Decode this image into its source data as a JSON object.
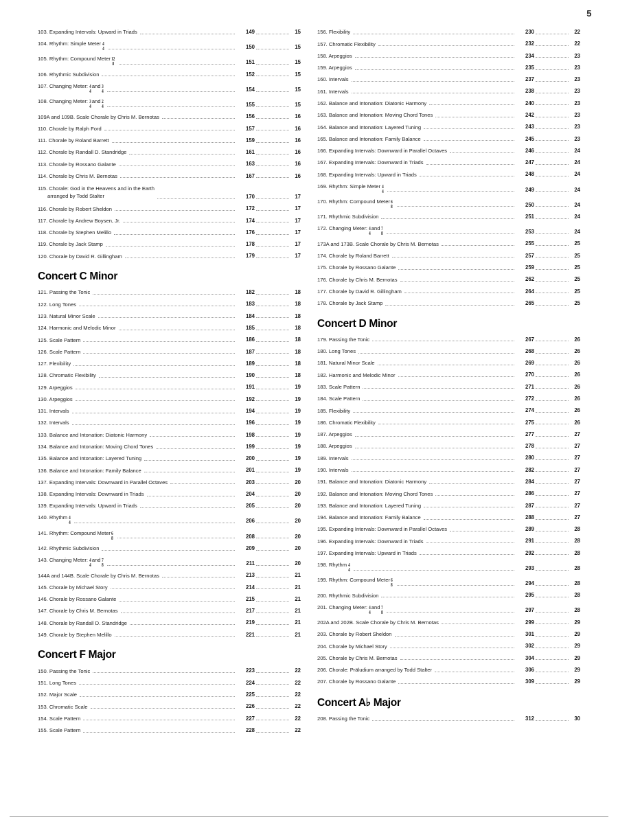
{
  "page": {
    "folio": "5"
  },
  "columns": [
    {
      "name": "left-column",
      "blocks": [
        {
          "type": "entries",
          "items": [
            {
              "num": "103.",
              "title": "Expanding Intervals: Upward in Triads",
              "ex": "149",
              "pg": "15"
            },
            {
              "num": "104.",
              "title": "Rhythm: Simple Meter",
              "meter": [
                "4",
                "4"
              ],
              "ex": "150",
              "pg": "15"
            },
            {
              "num": "105.",
              "title": "Rhythm: Compound Meter",
              "meter": [
                "12",
                "8"
              ],
              "ex": "151",
              "pg": "15"
            },
            {
              "num": "106.",
              "title": "Rhythmic Subdivision",
              "ex": "152",
              "pg": "15"
            },
            {
              "num": "107.",
              "title": "Changing Meter:",
              "meter": [
                "4",
                "4"
              ],
              "title2": "and",
              "meter2": [
                "3",
                "4"
              ],
              "ex": "154",
              "pg": "15"
            },
            {
              "num": "108.",
              "title": "Changing Meter:",
              "meter": [
                "3",
                "4"
              ],
              "title2": "and",
              "meter2": [
                "2",
                "4"
              ],
              "ex": "155",
              "pg": "15"
            },
            {
              "num": "109A and 109B.",
              "title": "Scale Chorale by Chris M. Bernotas",
              "ex": "156",
              "pg": "16"
            },
            {
              "num": "110.",
              "title": "Chorale by Ralph Ford",
              "ex": "157",
              "pg": "16"
            },
            {
              "num": "111.",
              "title": "Chorale by Roland Barrett",
              "ex": "159",
              "pg": "16"
            },
            {
              "num": "112.",
              "title": "Chorale by Randall D. Standridge",
              "ex": "161",
              "pg": "16"
            },
            {
              "num": "113.",
              "title": "Chorale by Rossano Galante",
              "ex": "163",
              "pg": "16"
            },
            {
              "num": "114.",
              "title": "Chorale by Chris M. Bernotas",
              "ex": "167",
              "pg": "16"
            },
            {
              "num": "115.",
              "title": "Chorale: God in the Heavens and in the Earth",
              "title_line2": "arranged by Todd Stalter",
              "ex": "170",
              "pg": "17"
            },
            {
              "num": "116.",
              "title": "Chorale by Robert Sheldon",
              "ex": "172",
              "pg": "17"
            },
            {
              "num": "117.",
              "title": "Chorale by Andrew Boysen, Jr.",
              "ex": "174",
              "pg": "17"
            },
            {
              "num": "118.",
              "title": "Chorale by Stephen Melillo",
              "ex": "176",
              "pg": "17"
            },
            {
              "num": "119.",
              "title": "Chorale by Jack Stamp",
              "ex": "178",
              "pg": "17"
            },
            {
              "num": "120.",
              "title": "Chorale by David R. Gillingham",
              "ex": "179",
              "pg": "17"
            }
          ]
        },
        {
          "type": "heading",
          "text": "Concert C Minor"
        },
        {
          "type": "entries",
          "items": [
            {
              "num": "121.",
              "title": "Passing the Tonic",
              "ex": "182",
              "pg": "18"
            },
            {
              "num": "122.",
              "title": "Long Tones",
              "ex": "183",
              "pg": "18"
            },
            {
              "num": "123.",
              "title": "Natural Minor Scale",
              "ex": "184",
              "pg": "18"
            },
            {
              "num": "124.",
              "title": "Harmonic and Melodic Minor",
              "ex": "185",
              "pg": "18"
            },
            {
              "num": "125.",
              "title": "Scale Pattern",
              "ex": "186",
              "pg": "18"
            },
            {
              "num": "126.",
              "title": "Scale Pattern",
              "ex": "187",
              "pg": "18"
            },
            {
              "num": "127.",
              "title": "Flexibility",
              "ex": "189",
              "pg": "18"
            },
            {
              "num": "128.",
              "title": "Chromatic Flexibility",
              "ex": "190",
              "pg": "18"
            },
            {
              "num": "129.",
              "title": "Arpeggios",
              "ex": "191",
              "pg": "19"
            },
            {
              "num": "130.",
              "title": "Arpeggios",
              "ex": "192",
              "pg": "19"
            },
            {
              "num": "131.",
              "title": "Intervals",
              "ex": "194",
              "pg": "19"
            },
            {
              "num": "132.",
              "title": "Intervals",
              "ex": "196",
              "pg": "19"
            },
            {
              "num": "133.",
              "title": "Balance and Intonation: Diatonic Harmony",
              "ex": "198",
              "pg": "19"
            },
            {
              "num": "134.",
              "title": "Balance and Intonation: Moving Chord Tones",
              "ex": "199",
              "pg": "19"
            },
            {
              "num": "135.",
              "title": "Balance and Intonation: Layered Tuning",
              "ex": "200",
              "pg": "19"
            },
            {
              "num": "136.",
              "title": "Balance and Intonation: Family Balance",
              "ex": "201",
              "pg": "19"
            },
            {
              "num": "137.",
              "title": "Expanding Intervals: Downward in Parallel Octaves",
              "ex": "203",
              "pg": "20"
            },
            {
              "num": "138.",
              "title": "Expanding Intervals: Downward in Triads",
              "ex": "204",
              "pg": "20"
            },
            {
              "num": "139.",
              "title": "Expanding Intervals: Upward in Triads",
              "ex": "205",
              "pg": "20"
            },
            {
              "num": "140.",
              "title": "Rhythm",
              "meter": [
                "4",
                "4"
              ],
              "ex": "206",
              "pg": "20"
            },
            {
              "num": "141.",
              "title": "Rhythm: Compound Meter",
              "meter": [
                "6",
                "8"
              ],
              "ex": "208",
              "pg": "20"
            },
            {
              "num": "142.",
              "title": "Rhythmic Subdivision",
              "ex": "209",
              "pg": "20"
            },
            {
              "num": "143.",
              "title": "Changing Meter:",
              "meter": [
                "4",
                "4"
              ],
              "title2": "and",
              "meter2": [
                "7",
                "8"
              ],
              "ex": "211",
              "pg": "20"
            },
            {
              "num": "144A and 144B.",
              "title": "Scale Chorale by Chris M. Bernotas",
              "ex": "213",
              "pg": "21"
            },
            {
              "num": "145.",
              "title": "Chorale by Michael Story",
              "ex": "214",
              "pg": "21"
            },
            {
              "num": "146.",
              "title": "Chorale by Rossano Galante",
              "ex": "215",
              "pg": "21"
            },
            {
              "num": "147.",
              "title": "Chorale by Chris M. Bernotas",
              "ex": "217",
              "pg": "21"
            },
            {
              "num": "148.",
              "title": "Chorale by Randall D. Standridge",
              "ex": "219",
              "pg": "21"
            },
            {
              "num": "149.",
              "title": "Chorale by Stephen Melillo",
              "ex": "221",
              "pg": "21"
            }
          ]
        },
        {
          "type": "heading",
          "text": "Concert F Major"
        },
        {
          "type": "entries",
          "items": [
            {
              "num": "150.",
              "title": "Passing the Tonic",
              "ex": "223",
              "pg": "22"
            },
            {
              "num": "151.",
              "title": "Long Tones",
              "ex": "224",
              "pg": "22"
            },
            {
              "num": "152.",
              "title": "Major Scale",
              "ex": "225",
              "pg": "22"
            },
            {
              "num": "153.",
              "title": "Chromatic Scale",
              "ex": "226",
              "pg": "22"
            },
            {
              "num": "154.",
              "title": "Scale Pattern",
              "ex": "227",
              "pg": "22"
            },
            {
              "num": "155.",
              "title": "Scale Pattern",
              "ex": "228",
              "pg": "22"
            }
          ]
        }
      ]
    },
    {
      "name": "right-column",
      "blocks": [
        {
          "type": "entries",
          "items": [
            {
              "num": "156.",
              "title": "Flexibility",
              "ex": "230",
              "pg": "22"
            },
            {
              "num": "157.",
              "title": "Chromatic Flexibility",
              "ex": "232",
              "pg": "22"
            },
            {
              "num": "158.",
              "title": "Arpeggios",
              "ex": "234",
              "pg": "23"
            },
            {
              "num": "159.",
              "title": "Arpeggios",
              "ex": "235",
              "pg": "23"
            },
            {
              "num": "160.",
              "title": "Intervals",
              "ex": "237",
              "pg": "23"
            },
            {
              "num": "161.",
              "title": "Intervals",
              "ex": "238",
              "pg": "23"
            },
            {
              "num": "162.",
              "title": "Balance and Intonation: Diatonic Harmony",
              "ex": "240",
              "pg": "23"
            },
            {
              "num": "163.",
              "title": "Balance and Intonation: Moving Chord Tones",
              "ex": "242",
              "pg": "23"
            },
            {
              "num": "164.",
              "title": "Balance and Intonation: Layered Tuning",
              "ex": "243",
              "pg": "23"
            },
            {
              "num": "165.",
              "title": "Balance and Intonation: Family Balance",
              "ex": "245",
              "pg": "23"
            },
            {
              "num": "166.",
              "title": "Expanding Intervals: Downward in Parallel Octaves",
              "ex": "246",
              "pg": "24"
            },
            {
              "num": "167.",
              "title": "Expanding Intervals: Downward in Triads",
              "ex": "247",
              "pg": "24"
            },
            {
              "num": "168.",
              "title": "Expanding Intervals: Upward in Triads",
              "ex": "248",
              "pg": "24"
            },
            {
              "num": "169.",
              "title": "Rhythm: Simple Meter",
              "meter": [
                "4",
                "4"
              ],
              "ex": "249",
              "pg": "24"
            },
            {
              "num": "170.",
              "title": "Rhythm: Compound Meter",
              "meter": [
                "6",
                "8"
              ],
              "ex": "250",
              "pg": "24"
            },
            {
              "num": "171.",
              "title": "Rhythmic Subdivision",
              "ex": "251",
              "pg": "24"
            },
            {
              "num": "172.",
              "title": "Changing Meter:",
              "meter": [
                "4",
                "4"
              ],
              "title2": "and",
              "meter2": [
                "7",
                "8"
              ],
              "ex": "253",
              "pg": "24"
            },
            {
              "num": "173A and 173B.",
              "title": "Scale Chorale by Chris M. Bernotas",
              "ex": "255",
              "pg": "25"
            },
            {
              "num": "174.",
              "title": "Chorale by Roland Barrett",
              "ex": "257",
              "pg": "25"
            },
            {
              "num": "175.",
              "title": "Chorale by Rossano Galante",
              "ex": "259",
              "pg": "25"
            },
            {
              "num": "176.",
              "title": "Chorale by Chris M. Bernotas",
              "ex": "262",
              "pg": "25"
            },
            {
              "num": "177.",
              "title": "Chorale by David R. Gillingham",
              "ex": "264",
              "pg": "25"
            },
            {
              "num": "178.",
              "title": "Chorale by Jack Stamp",
              "ex": "265",
              "pg": "25"
            }
          ]
        },
        {
          "type": "heading",
          "text": "Concert D Minor"
        },
        {
          "type": "entries",
          "items": [
            {
              "num": "179.",
              "title": "Passing the Tonic",
              "ex": "267",
              "pg": "26"
            },
            {
              "num": "180.",
              "title": "Long Tones",
              "ex": "268",
              "pg": "26"
            },
            {
              "num": "181.",
              "title": "Natural Minor Scale",
              "ex": "269",
              "pg": "26"
            },
            {
              "num": "182.",
              "title": "Harmonic and Melodic Minor",
              "ex": "270",
              "pg": "26"
            },
            {
              "num": "183.",
              "title": "Scale Pattern",
              "ex": "271",
              "pg": "26"
            },
            {
              "num": "184.",
              "title": "Scale Pattern",
              "ex": "272",
              "pg": "26"
            },
            {
              "num": "185.",
              "title": "Flexibility",
              "ex": "274",
              "pg": "26"
            },
            {
              "num": "186.",
              "title": "Chromatic Flexibility",
              "ex": "275",
              "pg": "26"
            },
            {
              "num": "187.",
              "title": "Arpeggios",
              "ex": "277",
              "pg": "27"
            },
            {
              "num": "188.",
              "title": "Arpeggios",
              "ex": "278",
              "pg": "27"
            },
            {
              "num": "189.",
              "title": "Intervals",
              "ex": "280",
              "pg": "27"
            },
            {
              "num": "190.",
              "title": "Intervals",
              "ex": "282",
              "pg": "27"
            },
            {
              "num": "191.",
              "title": "Balance and Intonation: Diatonic Harmony",
              "ex": "284",
              "pg": "27"
            },
            {
              "num": "192.",
              "title": "Balance and Intonation: Moving Chord Tones",
              "ex": "286",
              "pg": "27"
            },
            {
              "num": "193.",
              "title": "Balance and Intonation: Layered Tuning",
              "ex": "287",
              "pg": "27"
            },
            {
              "num": "194.",
              "title": "Balance and Intonation: Family Balance",
              "ex": "288",
              "pg": "27"
            },
            {
              "num": "195.",
              "title": "Expanding Intervals: Downward in Parallel Octaves",
              "ex": "289",
              "pg": "28"
            },
            {
              "num": "196.",
              "title": "Expanding Intervals: Downward in Triads",
              "ex": "291",
              "pg": "28"
            },
            {
              "num": "197.",
              "title": "Expanding Intervals: Upward in Triads",
              "ex": "292",
              "pg": "28"
            },
            {
              "num": "198.",
              "title": "Rhythm",
              "meter": [
                "4",
                "4"
              ],
              "ex": "293",
              "pg": "28"
            },
            {
              "num": "199.",
              "title": "Rhythm: Compound Meter",
              "meter": [
                "6",
                "8"
              ],
              "ex": "294",
              "pg": "28"
            },
            {
              "num": "200.",
              "title": "Rhythmic Subdivision",
              "ex": "295",
              "pg": "28"
            },
            {
              "num": "201.",
              "title": "Changing Meter:",
              "meter": [
                "4",
                "4"
              ],
              "title2": "and",
              "meter2": [
                "7",
                "8"
              ],
              "ex": "297",
              "pg": "28"
            },
            {
              "num": "202A and 202B.",
              "title": "Scale Chorale by Chris M. Bernotas",
              "ex": "299",
              "pg": "29"
            },
            {
              "num": "203.",
              "title": "Chorale by Robert Sheldon",
              "ex": "301",
              "pg": "29"
            },
            {
              "num": "204.",
              "title": "Chorale by Michael Story",
              "ex": "302",
              "pg": "29"
            },
            {
              "num": "205.",
              "title": "Chorale by Chris M. Bernotas",
              "ex": "304",
              "pg": "29"
            },
            {
              "num": "206.",
              "title": "Chorale: Präludium arranged by Todd Stalter",
              "ex": "306",
              "pg": "29"
            },
            {
              "num": "207.",
              "title": "Chorale by Rossano Galante",
              "ex": "309",
              "pg": "29"
            }
          ]
        },
        {
          "type": "heading",
          "text": "Concert A♭ Major"
        },
        {
          "type": "entries",
          "items": [
            {
              "num": "208.",
              "title": "Passing the Tonic",
              "ex": "312",
              "pg": "30"
            }
          ]
        }
      ]
    }
  ]
}
